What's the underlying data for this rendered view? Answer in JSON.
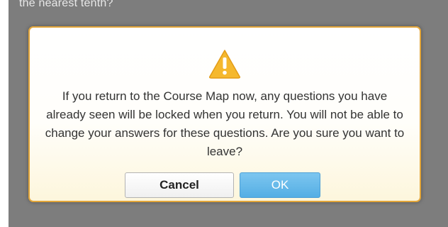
{
  "background": {
    "partial_text": "the nearest tenth?"
  },
  "dialog": {
    "icon": "warning-triangle-icon",
    "message": "If you return to the Course Map now, any questions you have already seen will be locked when you return. You will not be able to change your answers for these questions. Are you sure you want to leave?",
    "cancel_label": "Cancel",
    "ok_label": "OK"
  },
  "colors": {
    "overlay": "#7d7d7d",
    "dialog_border": "#e3a63a",
    "warning_icon": "#f5b82e",
    "ok_button": "#55aee4"
  }
}
